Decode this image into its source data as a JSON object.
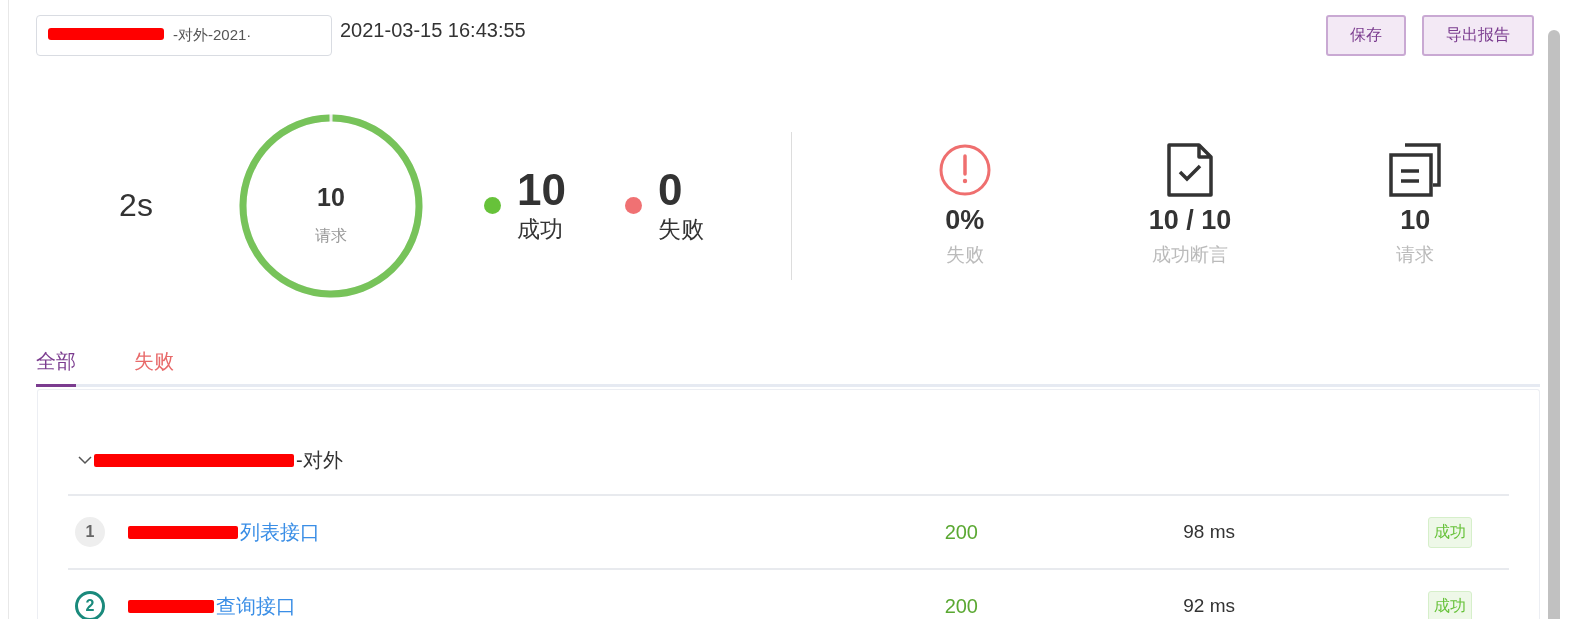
{
  "header": {
    "title_field": {
      "value": "-对外-2021·",
      "redacted": true
    },
    "timestamp": "2021-03-15 16:43:55",
    "buttons": [
      "保存",
      "导出报告"
    ]
  },
  "summary": {
    "duration": "2s",
    "ring": {
      "value": "10",
      "label": "请求",
      "level": 1
    },
    "counts": [
      {
        "value": "10",
        "label": "成功",
        "color": "#67c23a"
      },
      {
        "value": "0",
        "label": "失败",
        "color": "#f07173"
      }
    ]
  },
  "metrics": [
    {
      "kind": "alert",
      "value": "0%",
      "label": "失败"
    },
    {
      "kind": "document-check",
      "value": "10 / 10",
      "label": "成功断言"
    },
    {
      "kind": "copies",
      "value": "10",
      "label": "请求"
    }
  ],
  "tabs": [
    {
      "label": "全部",
      "selected": true,
      "color": "#7b3c8f"
    },
    {
      "label": "失败",
      "selected": false,
      "color": "#e86a6a"
    }
  ],
  "group": {
    "title": "-对外",
    "expanded": true,
    "redacted": true,
    "items": [
      {
        "index": "1",
        "name": "列表接口",
        "highlighted": false,
        "redacted": true,
        "status_code": "200",
        "duration": "98 ms",
        "result": "成功"
      },
      {
        "index": "2",
        "name": "查询接口",
        "highlighted": true,
        "redacted": true,
        "status_code": "200",
        "duration": "92 ms",
        "result": "成功"
      }
    ]
  }
}
